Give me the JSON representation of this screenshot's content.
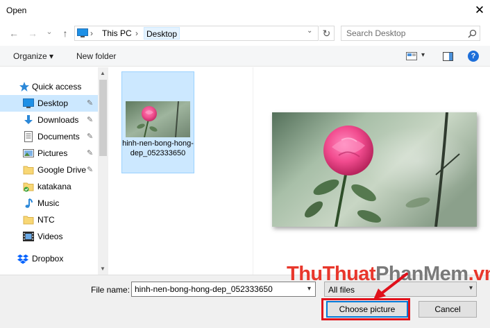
{
  "window": {
    "title": "Open",
    "close_glyph": "✕"
  },
  "nav": {
    "back_glyph": "←",
    "forward_glyph": "→",
    "recent_glyph": "⌄",
    "up_glyph": "↑",
    "breadcrumb": [
      "This PC",
      "Desktop"
    ],
    "refresh_glyph": "↻",
    "search_placeholder": "Search Desktop"
  },
  "toolbar": {
    "organize_label": "Organize ▾",
    "new_folder_label": "New folder",
    "view_arrow_glyph": "▾",
    "help_glyph": "?"
  },
  "sidebar": {
    "items": [
      {
        "label": "Quick access",
        "icon": "star-icon"
      },
      {
        "label": "Desktop",
        "icon": "desktop-icon",
        "pinned": true,
        "selected": true
      },
      {
        "label": "Downloads",
        "icon": "download-icon",
        "pinned": true
      },
      {
        "label": "Documents",
        "icon": "documents-icon",
        "pinned": true
      },
      {
        "label": "Pictures",
        "icon": "pictures-icon",
        "pinned": true
      },
      {
        "label": "Google Drive",
        "icon": "folder-icon",
        "pinned": true
      },
      {
        "label": "katakana",
        "icon": "folder-sync-icon"
      },
      {
        "label": "Music",
        "icon": "music-icon"
      },
      {
        "label": "NTC",
        "icon": "folder-icon"
      },
      {
        "label": "Videos",
        "icon": "videos-icon"
      },
      {
        "label": "Dropbox",
        "icon": "dropbox-icon"
      }
    ],
    "pin_glyph": "📌",
    "expand_glyph": "›"
  },
  "files": [
    {
      "name": "hinh-nen-bong-hong-dep_052333650",
      "selected": true
    }
  ],
  "footer": {
    "file_name_label": "File name:",
    "file_name_value": "hinh-nen-bong-hong-dep_052333650",
    "file_type_value": "All files",
    "open_button": "Choose picture",
    "cancel_button": "Cancel"
  },
  "watermark": {
    "part1": "ThuThuat",
    "part2": "PhanMem",
    "part3": ".vn"
  },
  "colors": {
    "accent": "#0078d7",
    "selection": "#cce8ff",
    "highlight_red": "#e0111b"
  }
}
